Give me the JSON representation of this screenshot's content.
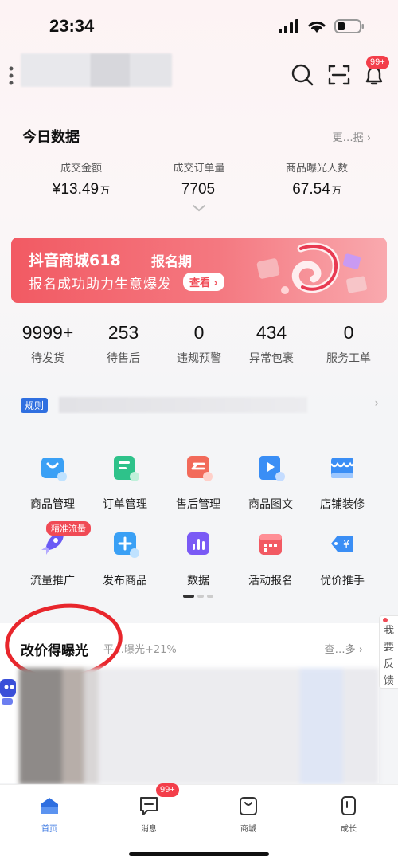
{
  "status_bar": {
    "time": "23:34"
  },
  "header": {
    "notification_badge": "99+"
  },
  "today": {
    "title": "今日数据",
    "more": "更…据 ›",
    "metrics": [
      {
        "label": "成交金额",
        "value": "¥13.49",
        "unit": "万"
      },
      {
        "label": "成交订单量",
        "value": "7705",
        "unit": ""
      },
      {
        "label": "商品曝光人数",
        "value": "67.54",
        "unit": "万"
      }
    ]
  },
  "banner": {
    "title": "抖音商城618",
    "tag": "报名期",
    "subtitle": "报名成功助力生意爆发",
    "button": "查看 ›"
  },
  "stats": [
    {
      "num": "9999+",
      "label": "待发货"
    },
    {
      "num": "253",
      "label": "待售后"
    },
    {
      "num": "0",
      "label": "违规预警"
    },
    {
      "num": "434",
      "label": "异常包裹"
    },
    {
      "num": "0",
      "label": "服务工单"
    }
  ],
  "rules": {
    "tag": "规则",
    "arrow": "›"
  },
  "grid": {
    "row1": [
      {
        "label": "商品管理",
        "icon": "shopping-bag-icon",
        "color": "#3aa0f5"
      },
      {
        "label": "订单管理",
        "icon": "order-list-icon",
        "color": "#2ec28a"
      },
      {
        "label": "售后管理",
        "icon": "return-icon",
        "color": "#f26a5a"
      },
      {
        "label": "商品图文",
        "icon": "media-play-icon",
        "color": "#3a8ef5"
      },
      {
        "label": "店铺装修",
        "icon": "storefront-icon",
        "color": "#3a8ef5"
      }
    ],
    "row2": [
      {
        "label": "流量推广",
        "icon": "rocket-icon",
        "color": "#6a5af5"
      },
      {
        "label": "发布商品",
        "icon": "plus-icon",
        "color": "#3aa0f5"
      },
      {
        "label": "数据",
        "icon": "bar-chart-icon",
        "color": "#7a5af5"
      },
      {
        "label": "活动报名",
        "icon": "calendar-icon",
        "color": "#f25a63"
      },
      {
        "label": "优价推手",
        "icon": "price-tag-icon",
        "color": "#3a8ef5"
      }
    ],
    "promo_badge": "精准流量"
  },
  "promo": {
    "title": "改价得曝光",
    "subtitle": "平…曝光+21%",
    "more": "查…多 ›"
  },
  "feedback": {
    "line1": "我",
    "line2": "要",
    "line3": "反",
    "line4": "馈"
  },
  "tabbar": {
    "tabs": [
      {
        "label": "首页",
        "icon": "home-icon",
        "active": true
      },
      {
        "label": "消息",
        "icon": "message-icon",
        "badge": "99+"
      },
      {
        "label": "商城",
        "icon": "mall-bag-icon"
      },
      {
        "label": "成长",
        "icon": "growth-icon"
      }
    ]
  }
}
